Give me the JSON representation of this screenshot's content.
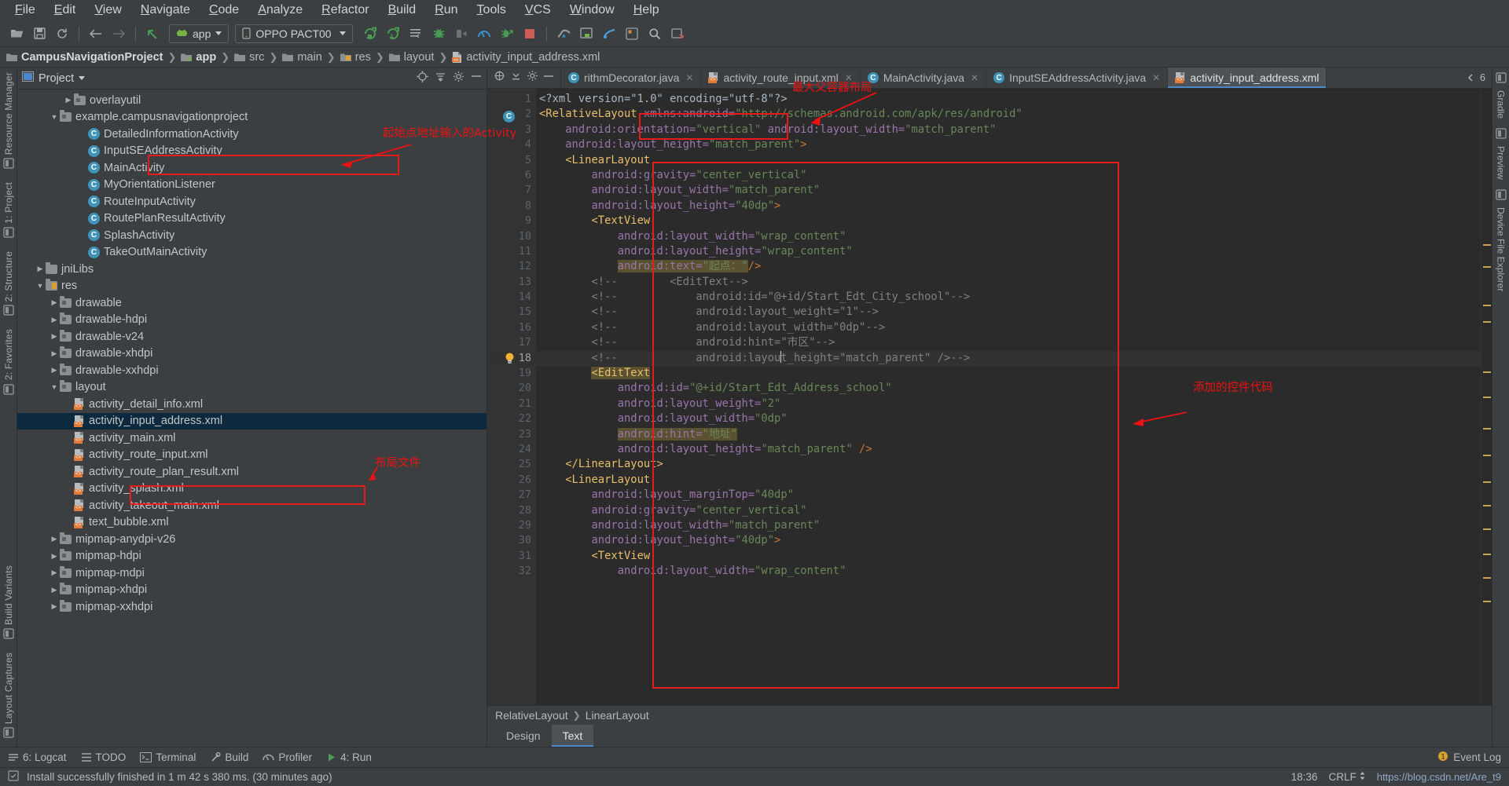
{
  "menubar": {
    "items": [
      "File",
      "Edit",
      "View",
      "Navigate",
      "Code",
      "Analyze",
      "Refactor",
      "Build",
      "Run",
      "Tools",
      "VCS",
      "Window",
      "Help"
    ]
  },
  "toolbar": {
    "module_selector": "app",
    "device_selector": "OPPO PACT00",
    "icons": [
      "open-folder-icon",
      "save-icon",
      "sync-icon",
      "back-arrow-icon",
      "forward-arrow-icon",
      "undo-icon",
      "run-icon",
      "run-with-coverage-icon",
      "apply-changes-icon",
      "debug-icon",
      "attach-debugger-icon",
      "profiler-icon",
      "run-anything-icon",
      "stop-icon",
      "sdk-manager-icon",
      "avd-manager-icon",
      "gradle-sync-icon",
      "project-structure-icon",
      "search-everywhere-icon",
      "layout-inspector-icon"
    ]
  },
  "breadcrumb": {
    "items": [
      {
        "label": "CampusNavigationProject",
        "icon": "folder-icon",
        "bold": true
      },
      {
        "label": "app",
        "icon": "module-icon",
        "bold": true
      },
      {
        "label": "src",
        "icon": "folder-icon",
        "bold": false
      },
      {
        "label": "main",
        "icon": "folder-icon",
        "bold": false
      },
      {
        "label": "res",
        "icon": "res-folder-icon",
        "bold": false
      },
      {
        "label": "layout",
        "icon": "folder-icon",
        "bold": false
      },
      {
        "label": "activity_input_address.xml",
        "icon": "xml-file-icon",
        "bold": false
      }
    ]
  },
  "left_rail": {
    "top": [
      "Resource Manager",
      "1: Project",
      "2: Structure",
      "2: Favorites"
    ],
    "bottom": [
      "Build Variants",
      "Layout Captures"
    ]
  },
  "right_rail": {
    "items": [
      "Gradle",
      "Preview",
      "Device File Explorer"
    ]
  },
  "project_panel": {
    "title": "Project",
    "tree": [
      {
        "indent": 3,
        "twist": "▶",
        "icon": "package-folder-icon",
        "label": "overlayutil",
        "selected": false
      },
      {
        "indent": 2,
        "twist": "▼",
        "icon": "package-folder-icon",
        "label": "example.campusnavigationproject",
        "selected": false
      },
      {
        "indent": 4,
        "twist": "",
        "icon": "java-class-icon",
        "label": "DetailedInformationActivity",
        "selected": false
      },
      {
        "indent": 4,
        "twist": "",
        "icon": "java-class-icon",
        "label": "InputSEAddressActivity",
        "selected": false
      },
      {
        "indent": 4,
        "twist": "",
        "icon": "java-class-icon",
        "label": "MainActivity",
        "selected": false
      },
      {
        "indent": 4,
        "twist": "",
        "icon": "java-class-icon",
        "label": "MyOrientationListener",
        "selected": false
      },
      {
        "indent": 4,
        "twist": "",
        "icon": "java-class-icon",
        "label": "RouteInputActivity",
        "selected": false
      },
      {
        "indent": 4,
        "twist": "",
        "icon": "java-class-icon",
        "label": "RoutePlanResultActivity",
        "selected": false
      },
      {
        "indent": 4,
        "twist": "",
        "icon": "java-class-icon",
        "label": "SplashActivity",
        "selected": false
      },
      {
        "indent": 4,
        "twist": "",
        "icon": "java-class-icon",
        "label": "TakeOutMainActivity",
        "selected": false
      },
      {
        "indent": 1,
        "twist": "▶",
        "icon": "folder-icon",
        "label": "jniLibs",
        "selected": false
      },
      {
        "indent": 1,
        "twist": "▼",
        "icon": "res-folder-icon",
        "label": "res",
        "selected": false
      },
      {
        "indent": 2,
        "twist": "▶",
        "icon": "package-folder-icon",
        "label": "drawable",
        "selected": false
      },
      {
        "indent": 2,
        "twist": "▶",
        "icon": "package-folder-icon",
        "label": "drawable-hdpi",
        "selected": false
      },
      {
        "indent": 2,
        "twist": "▶",
        "icon": "package-folder-icon",
        "label": "drawable-v24",
        "selected": false
      },
      {
        "indent": 2,
        "twist": "▶",
        "icon": "package-folder-icon",
        "label": "drawable-xhdpi",
        "selected": false
      },
      {
        "indent": 2,
        "twist": "▶",
        "icon": "package-folder-icon",
        "label": "drawable-xxhdpi",
        "selected": false
      },
      {
        "indent": 2,
        "twist": "▼",
        "icon": "package-folder-icon",
        "label": "layout",
        "selected": false
      },
      {
        "indent": 3,
        "twist": "",
        "icon": "xml-file-icon",
        "label": "activity_detail_info.xml",
        "selected": false
      },
      {
        "indent": 3,
        "twist": "",
        "icon": "xml-file-icon",
        "label": "activity_input_address.xml",
        "selected": true
      },
      {
        "indent": 3,
        "twist": "",
        "icon": "xml-file-icon",
        "label": "activity_main.xml",
        "selected": false
      },
      {
        "indent": 3,
        "twist": "",
        "icon": "xml-file-icon",
        "label": "activity_route_input.xml",
        "selected": false
      },
      {
        "indent": 3,
        "twist": "",
        "icon": "xml-file-icon",
        "label": "activity_route_plan_result.xml",
        "selected": false
      },
      {
        "indent": 3,
        "twist": "",
        "icon": "xml-file-icon",
        "label": "activity_splash.xml",
        "selected": false
      },
      {
        "indent": 3,
        "twist": "",
        "icon": "xml-file-icon",
        "label": "activity_takeout_main.xml",
        "selected": false
      },
      {
        "indent": 3,
        "twist": "",
        "icon": "xml-file-icon",
        "label": "text_bubble.xml",
        "selected": false
      },
      {
        "indent": 2,
        "twist": "▶",
        "icon": "package-folder-icon",
        "label": "mipmap-anydpi-v26",
        "selected": false
      },
      {
        "indent": 2,
        "twist": "▶",
        "icon": "package-folder-icon",
        "label": "mipmap-hdpi",
        "selected": false
      },
      {
        "indent": 2,
        "twist": "▶",
        "icon": "package-folder-icon",
        "label": "mipmap-mdpi",
        "selected": false
      },
      {
        "indent": 2,
        "twist": "▶",
        "icon": "package-folder-icon",
        "label": "mipmap-xhdpi",
        "selected": false
      },
      {
        "indent": 2,
        "twist": "▶",
        "icon": "package-folder-icon",
        "label": "mipmap-xxhdpi",
        "selected": false
      }
    ]
  },
  "editor": {
    "tabs": [
      {
        "label": "rithmDecorator.java",
        "icon": "java-class-icon",
        "active": false,
        "closable": true
      },
      {
        "label": "activity_route_input.xml",
        "icon": "xml-file-icon",
        "active": false,
        "closable": true
      },
      {
        "label": "MainActivity.java",
        "icon": "java-class-icon",
        "active": false,
        "closable": true
      },
      {
        "label": "InputSEAddressActivity.java",
        "icon": "java-class-icon",
        "active": false,
        "closable": true
      },
      {
        "label": "activity_input_address.xml",
        "icon": "xml-file-icon",
        "active": true,
        "closable": false
      }
    ],
    "tab_overflow": "6",
    "lines": [
      {
        "n": 1,
        "indent": 0,
        "tokens": [
          {
            "t": "<?xml version=\"1.0\" encoding=\"utf-8\"?>",
            "c": "k-plain"
          }
        ]
      },
      {
        "n": 2,
        "indent": 0,
        "tokens": [
          {
            "t": "<RelativeLayout ",
            "c": "k-tag"
          },
          {
            "t": "xmlns:android=",
            "c": "k-attr"
          },
          {
            "t": "\"http://schemas.android.com/apk/res/android\"",
            "c": "k-val"
          }
        ]
      },
      {
        "n": 3,
        "indent": 1,
        "tokens": [
          {
            "t": "android:orientation=",
            "c": "k-attr"
          },
          {
            "t": "\"vertical\"",
            "c": "k-val"
          },
          {
            "t": " android:layout_width=",
            "c": "k-attr"
          },
          {
            "t": "\"match_parent\"",
            "c": "k-val"
          }
        ]
      },
      {
        "n": 4,
        "indent": 1,
        "tokens": [
          {
            "t": "android:layout_height=",
            "c": "k-attr"
          },
          {
            "t": "\"match_parent\"",
            "c": "k-val"
          },
          {
            "t": ">",
            "c": "k-punct"
          }
        ]
      },
      {
        "n": 5,
        "indent": 1,
        "tokens": [
          {
            "t": "<LinearLayout",
            "c": "k-tag"
          }
        ]
      },
      {
        "n": 6,
        "indent": 2,
        "tokens": [
          {
            "t": "android:gravity=",
            "c": "k-attr"
          },
          {
            "t": "\"center_vertical\"",
            "c": "k-val"
          }
        ]
      },
      {
        "n": 7,
        "indent": 2,
        "tokens": [
          {
            "t": "android:layout_width=",
            "c": "k-attr"
          },
          {
            "t": "\"match_parent\"",
            "c": "k-val"
          }
        ]
      },
      {
        "n": 8,
        "indent": 2,
        "tokens": [
          {
            "t": "android:layout_height=",
            "c": "k-attr"
          },
          {
            "t": "\"40dp\"",
            "c": "k-val"
          },
          {
            "t": ">",
            "c": "k-punct"
          }
        ]
      },
      {
        "n": 9,
        "indent": 2,
        "tokens": [
          {
            "t": "<TextView",
            "c": "k-tag"
          }
        ]
      },
      {
        "n": 10,
        "indent": 3,
        "tokens": [
          {
            "t": "android:layout_width=",
            "c": "k-attr"
          },
          {
            "t": "\"wrap_content\"",
            "c": "k-val"
          }
        ]
      },
      {
        "n": 11,
        "indent": 3,
        "tokens": [
          {
            "t": "android:layout_height=",
            "c": "k-attr"
          },
          {
            "t": "\"wrap_content\"",
            "c": "k-val"
          }
        ]
      },
      {
        "n": 12,
        "indent": 3,
        "tokens": [
          {
            "t": "android:text=",
            "c": "k-attr hl"
          },
          {
            "t": "\"起点：\"",
            "c": "k-val hl"
          },
          {
            "t": "/>",
            "c": "k-punct"
          }
        ]
      },
      {
        "n": 13,
        "indent": 2,
        "tokens": [
          {
            "t": "<!--        <EditText-->",
            "c": "k-cmt"
          }
        ]
      },
      {
        "n": 14,
        "indent": 2,
        "tokens": [
          {
            "t": "<!--            android:id=\"@+id/Start_Edt_City_school\"-->",
            "c": "k-cmt"
          }
        ]
      },
      {
        "n": 15,
        "indent": 2,
        "tokens": [
          {
            "t": "<!--            android:layout_weight=\"1\"-->",
            "c": "k-cmt"
          }
        ]
      },
      {
        "n": 16,
        "indent": 2,
        "tokens": [
          {
            "t": "<!--            android:layout_width=\"0dp\"-->",
            "c": "k-cmt"
          }
        ]
      },
      {
        "n": 17,
        "indent": 2,
        "tokens": [
          {
            "t": "<!--            android:hint=\"市区\"-->",
            "c": "k-cmt"
          }
        ]
      },
      {
        "n": 18,
        "indent": 2,
        "tokens": [
          {
            "t": "<!--            android:layout_height=\"match_parent\" />-->",
            "c": "k-cmt"
          }
        ],
        "current": true,
        "bulb": true
      },
      {
        "n": 19,
        "indent": 2,
        "tokens": [
          {
            "t": "<EditText",
            "c": "k-tag hl"
          }
        ]
      },
      {
        "n": 20,
        "indent": 3,
        "tokens": [
          {
            "t": "android:id=",
            "c": "k-attr"
          },
          {
            "t": "\"@+id/Start_Edt_Address_school\"",
            "c": "k-val"
          }
        ]
      },
      {
        "n": 21,
        "indent": 3,
        "tokens": [
          {
            "t": "android:layout_weight=",
            "c": "k-attr"
          },
          {
            "t": "\"2\"",
            "c": "k-val"
          }
        ]
      },
      {
        "n": 22,
        "indent": 3,
        "tokens": [
          {
            "t": "android:layout_width=",
            "c": "k-attr"
          },
          {
            "t": "\"0dp\"",
            "c": "k-val"
          }
        ]
      },
      {
        "n": 23,
        "indent": 3,
        "tokens": [
          {
            "t": "android:hint=",
            "c": "k-attr hl"
          },
          {
            "t": "\"地址\"",
            "c": "k-val hl"
          }
        ]
      },
      {
        "n": 24,
        "indent": 3,
        "tokens": [
          {
            "t": "android:layout_height=",
            "c": "k-attr"
          },
          {
            "t": "\"match_parent\"",
            "c": "k-val"
          },
          {
            "t": " />",
            "c": "k-punct"
          }
        ]
      },
      {
        "n": 25,
        "indent": 1,
        "tokens": [
          {
            "t": "</LinearLayout>",
            "c": "k-tag"
          }
        ]
      },
      {
        "n": 26,
        "indent": 1,
        "tokens": [
          {
            "t": "<LinearLayout",
            "c": "k-tag"
          }
        ]
      },
      {
        "n": 27,
        "indent": 2,
        "tokens": [
          {
            "t": "android:layout_marginTop=",
            "c": "k-attr"
          },
          {
            "t": "\"40dp\"",
            "c": "k-val"
          }
        ]
      },
      {
        "n": 28,
        "indent": 2,
        "tokens": [
          {
            "t": "android:gravity=",
            "c": "k-attr"
          },
          {
            "t": "\"center_vertical\"",
            "c": "k-val"
          }
        ]
      },
      {
        "n": 29,
        "indent": 2,
        "tokens": [
          {
            "t": "android:layout_width=",
            "c": "k-attr"
          },
          {
            "t": "\"match_parent\"",
            "c": "k-val"
          }
        ]
      },
      {
        "n": 30,
        "indent": 2,
        "tokens": [
          {
            "t": "android:layout_height=",
            "c": "k-attr"
          },
          {
            "t": "\"40dp\"",
            "c": "k-val"
          },
          {
            "t": ">",
            "c": "k-punct"
          }
        ]
      },
      {
        "n": 31,
        "indent": 2,
        "tokens": [
          {
            "t": "<TextView",
            "c": "k-tag"
          }
        ]
      },
      {
        "n": 32,
        "indent": 3,
        "tokens": [
          {
            "t": "android:layout_width=",
            "c": "k-attr"
          },
          {
            "t": "\"wrap_content\"",
            "c": "k-val"
          }
        ]
      }
    ],
    "component_breadcrumb": [
      "RelativeLayout",
      "LinearLayout"
    ],
    "design_text_tabs": [
      {
        "label": "Design",
        "active": false
      },
      {
        "label": "Text",
        "active": true
      }
    ]
  },
  "tool_windows": {
    "items": [
      {
        "label": "6: Logcat",
        "icon": "logcat-icon"
      },
      {
        "label": "TODO",
        "icon": "todo-icon"
      },
      {
        "label": "Terminal",
        "icon": "terminal-icon"
      },
      {
        "label": "Build",
        "icon": "build-icon"
      },
      {
        "label": "Profiler",
        "icon": "profiler-icon"
      },
      {
        "label": "4: Run",
        "icon": "run-icon"
      }
    ],
    "event_log": "Event Log"
  },
  "statusbar": {
    "message": "Install successfully finished in 1 m 42 s 380 ms. (30 minutes ago)",
    "time": "18:36",
    "line_separator": "CRLF",
    "watermark": "https://blog.csdn.net/Are_t9"
  },
  "annotations": [
    {
      "id": "anno-activity",
      "text": "起始点地址输入的Activity"
    },
    {
      "id": "anno-layout-file",
      "text": "布局文件"
    },
    {
      "id": "anno-root-container",
      "text": "最大父容器布局"
    },
    {
      "id": "anno-widget-code",
      "text": "添加的控件代码"
    }
  ],
  "colors": {
    "accent_blue": "#4a88c7",
    "annotation_red": "#e81b1b",
    "selection_blue": "#0d293e",
    "editor_bg": "#2b2b2b",
    "chrome_bg": "#3c3f41"
  }
}
